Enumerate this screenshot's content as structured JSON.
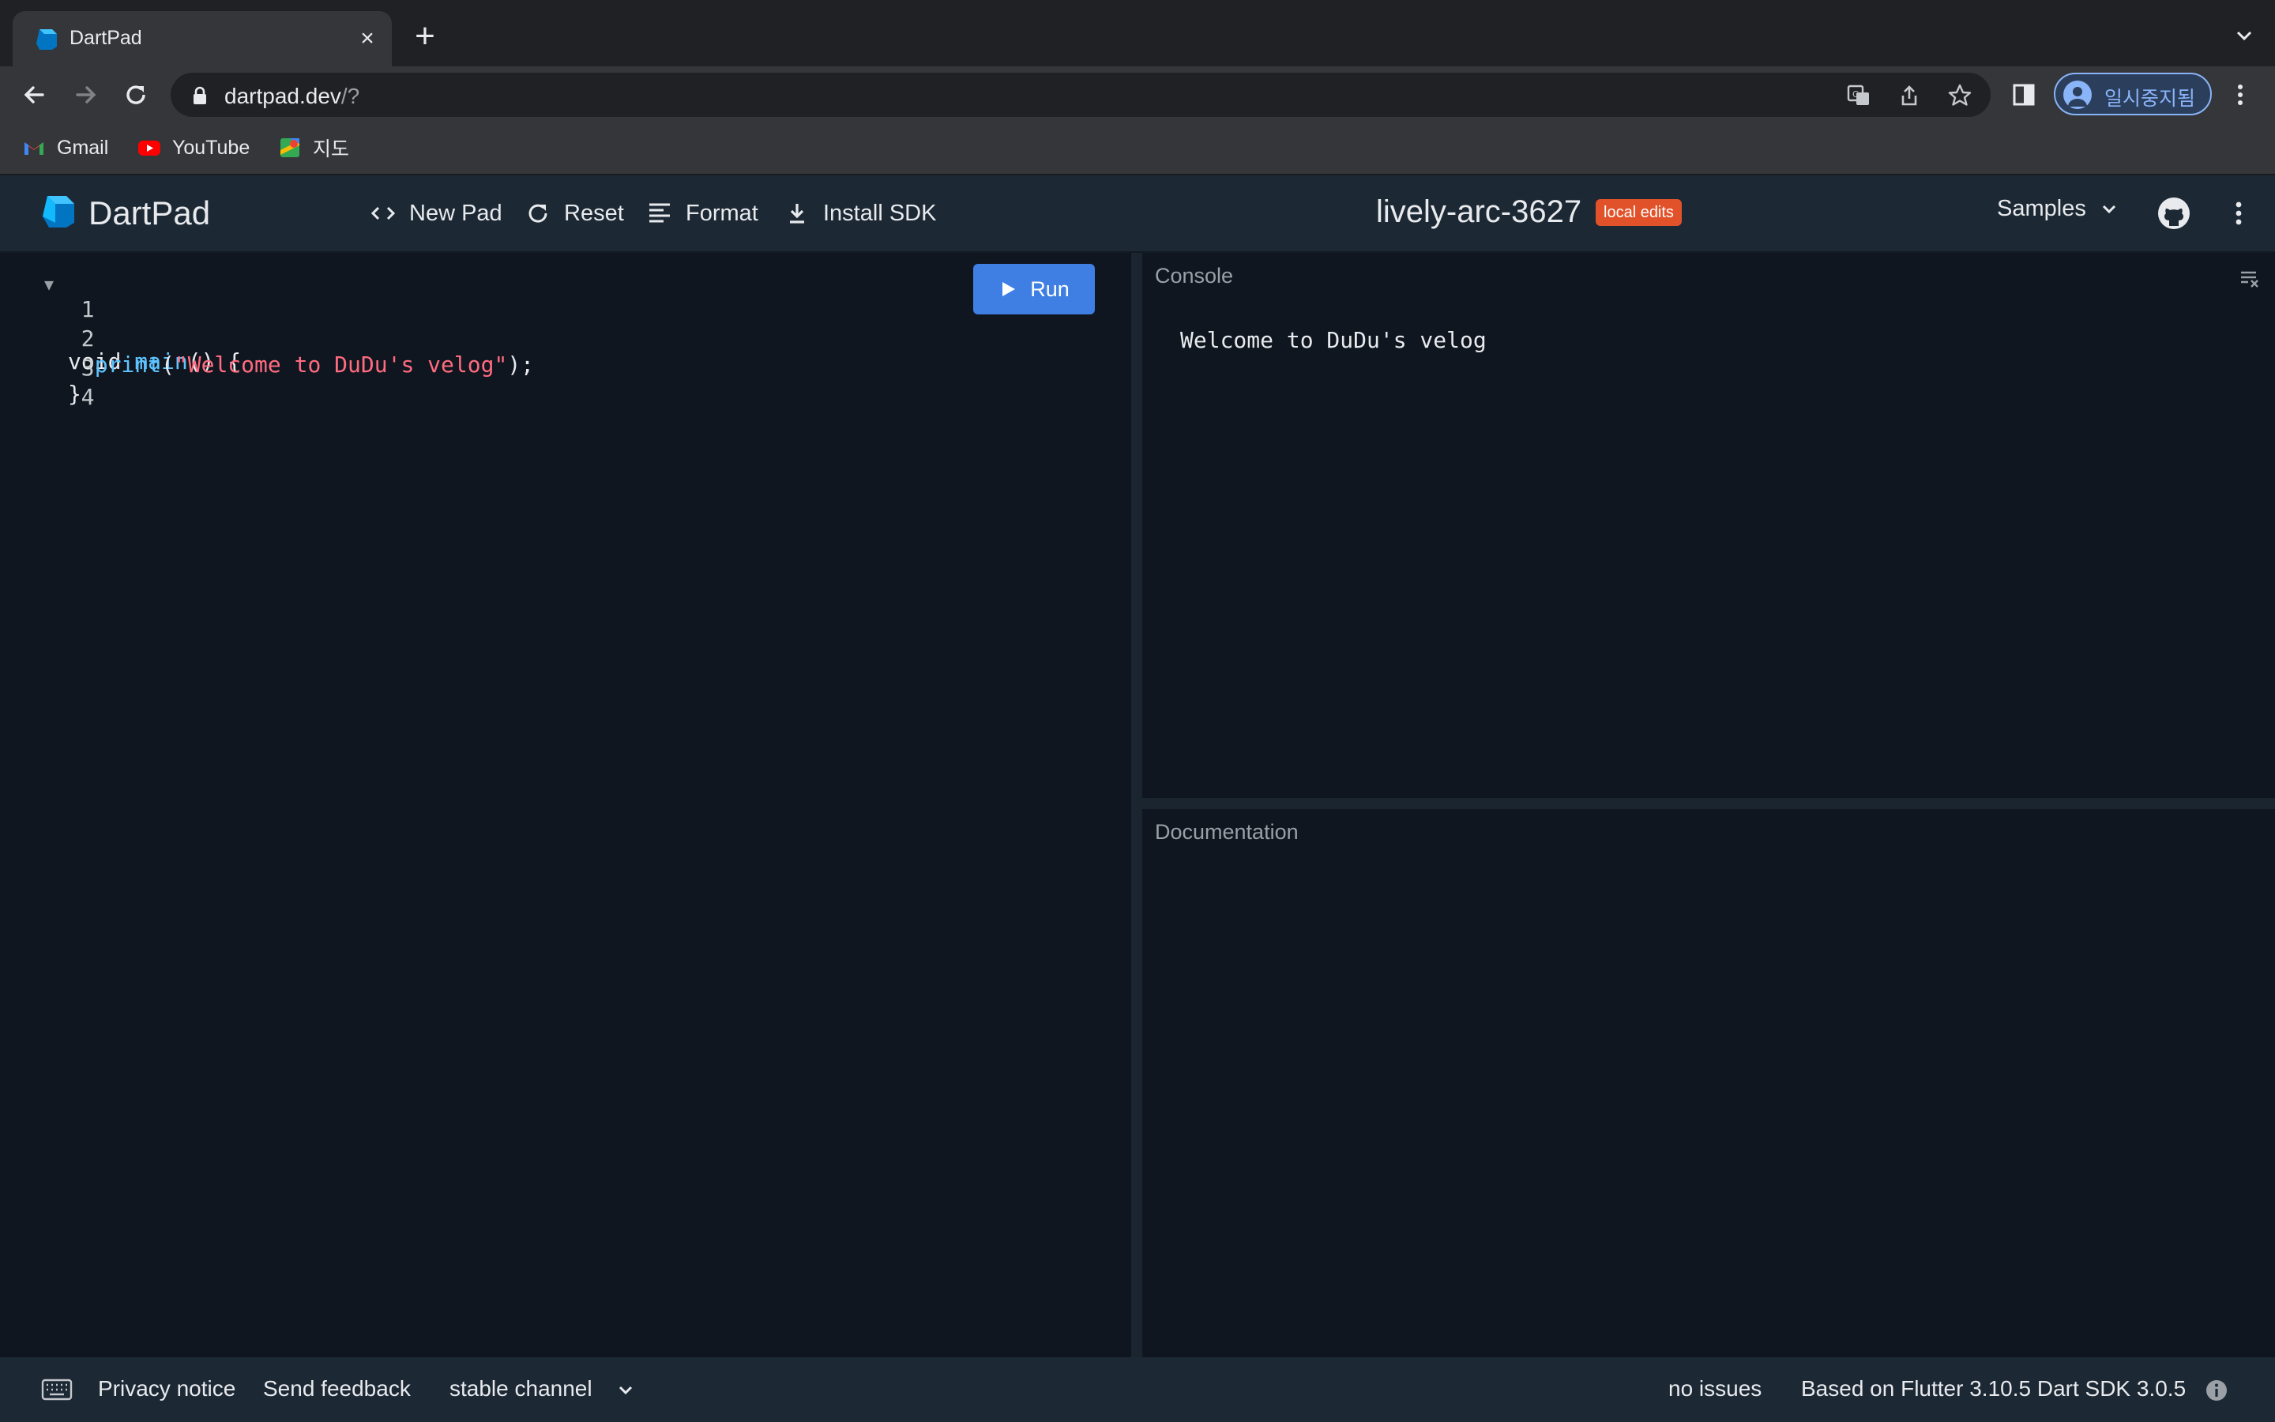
{
  "browser": {
    "tab": {
      "title": "DartPad",
      "close_icon": "close-icon"
    },
    "new_tab_label": "+",
    "address": {
      "host": "dartpad.dev",
      "path": "/?"
    },
    "profile_label": "일시중지됨",
    "bookmarks": [
      {
        "label": "Gmail",
        "icon": "gmail-icon"
      },
      {
        "label": "YouTube",
        "icon": "youtube-icon"
      },
      {
        "label": "지도",
        "icon": "maps-icon"
      }
    ]
  },
  "app": {
    "name": "DartPad",
    "toolbar": {
      "new_pad": "New Pad",
      "reset": "Reset",
      "format": "Format",
      "install_sdk": "Install SDK"
    },
    "pad_name": "lively-arc-3627",
    "badge": "local edits",
    "samples": "Samples"
  },
  "editor": {
    "run_label": "Run",
    "line_numbers": [
      "1",
      "2",
      "3",
      "4"
    ],
    "lines": [
      {
        "a": "void ",
        "b": "main",
        "c": "() {",
        "d": "",
        "e": "",
        "f": ""
      },
      {
        "a": "  ",
        "b": "print",
        "c": "(",
        "d": "\"Welcome to DuDu's velog\"",
        "e": ");",
        "f": ""
      },
      {
        "a": "}",
        "b": "",
        "c": "",
        "d": "",
        "e": "",
        "f": ""
      },
      {
        "a": "",
        "b": "",
        "c": "",
        "d": "",
        "e": "",
        "f": ""
      }
    ]
  },
  "console": {
    "title": "Console",
    "output": "Welcome to DuDu's velog"
  },
  "documentation": {
    "title": "Documentation"
  },
  "footer": {
    "privacy": "Privacy notice",
    "feedback": "Send feedback",
    "channel": "stable channel",
    "issues": "no issues",
    "version": "Based on Flutter 3.10.5 Dart SDK 3.0.5"
  },
  "colors": {
    "run_button": "#3f7fe3",
    "badge": "#e2522a",
    "string": "#ff6b7f",
    "function": "#5ec4ff"
  }
}
